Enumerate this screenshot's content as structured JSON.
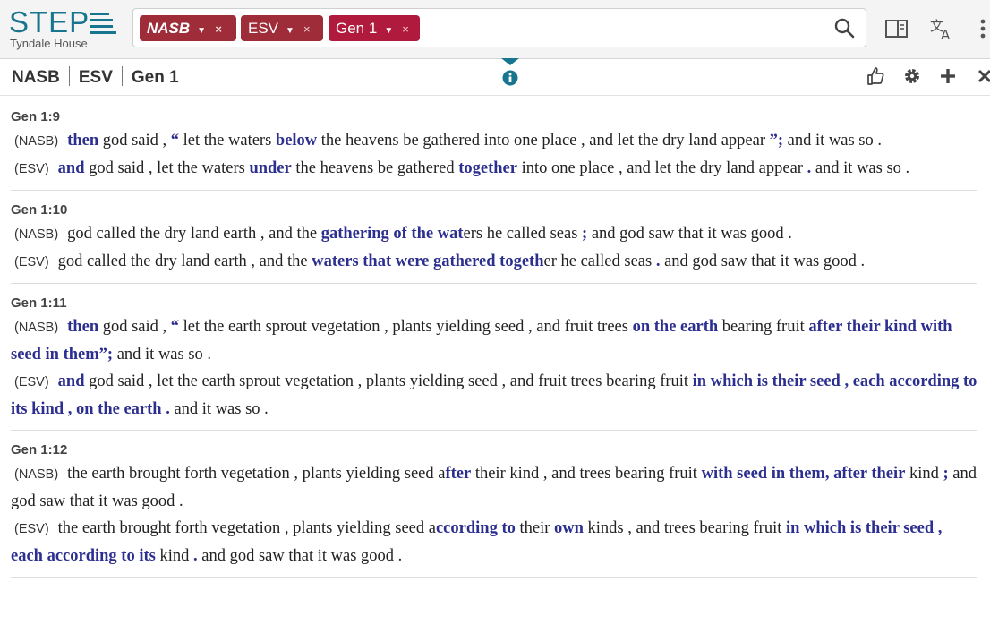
{
  "logo": {
    "name": "STEP",
    "subtitle": "Tyndale House"
  },
  "search_chips": [
    {
      "label": "NASB",
      "remove": "×"
    },
    {
      "label": "ESV",
      "remove": "×"
    },
    {
      "label": "Gen 1",
      "remove": "×"
    }
  ],
  "passage_bar": {
    "versions": [
      "NASB",
      "ESV"
    ],
    "reference": "Gen 1"
  },
  "colors": {
    "brand": "#17758f",
    "chip": "#9e2d39",
    "chip_ref": "#b01a3c",
    "highlight": "#2c2f8f"
  },
  "icons": [
    "search-icon",
    "panel-icon",
    "translate-icon",
    "more-icon",
    "info-icon",
    "thumbs-up-icon",
    "gear-icon",
    "plus-icon",
    "close-icon"
  ],
  "verses": [
    {
      "ref": "Gen 1:9",
      "rows": [
        {
          "version": "(NASB)",
          "segments": [
            {
              "t": "then",
              "h": true
            },
            {
              "t": " god said , "
            },
            {
              "t": "“",
              "h": true
            },
            {
              "t": " let the waters "
            },
            {
              "t": "below",
              "h": true
            },
            {
              "t": " the heavens be gathered into one place , and let the dry land appear "
            },
            {
              "t": "”;",
              "h": true
            },
            {
              "t": " and it was so ."
            }
          ]
        },
        {
          "version": "(ESV)",
          "segments": [
            {
              "t": "and",
              "h": true
            },
            {
              "t": " god said , let the waters "
            },
            {
              "t": "under",
              "h": true
            },
            {
              "t": " the heavens be gathered "
            },
            {
              "t": "together",
              "h": true
            },
            {
              "t": " into one place , and let the dry land appear "
            },
            {
              "t": ".",
              "h": true
            },
            {
              "t": " and it was so ."
            }
          ]
        }
      ]
    },
    {
      "ref": "Gen 1:10",
      "rows": [
        {
          "version": "(NASB)",
          "segments": [
            {
              "t": "god called the dry land earth , and the "
            },
            {
              "t": "gathering of the wat",
              "h": true
            },
            {
              "t": "ers he called seas "
            },
            {
              "t": ";",
              "h": true
            },
            {
              "t": " and god saw that it was good ."
            }
          ]
        },
        {
          "version": "(ESV)",
          "segments": [
            {
              "t": "god called the dry land earth , and the "
            },
            {
              "t": "waters that were gathered togeth",
              "h": true
            },
            {
              "t": "er he called seas "
            },
            {
              "t": ".",
              "h": true
            },
            {
              "t": " and god saw that it was good ."
            }
          ]
        }
      ]
    },
    {
      "ref": "Gen 1:11",
      "rows": [
        {
          "version": "(NASB)",
          "segments": [
            {
              "t": "then",
              "h": true
            },
            {
              "t": " god said , "
            },
            {
              "t": "“",
              "h": true
            },
            {
              "t": " let the earth sprout vegetation , plants yielding seed , and fruit trees "
            },
            {
              "t": "on the earth",
              "h": true
            },
            {
              "t": " bearing fruit "
            },
            {
              "t": "after their kind with seed in them”;",
              "h": true
            },
            {
              "t": " and it was so ."
            }
          ]
        },
        {
          "version": "(ESV)",
          "segments": [
            {
              "t": "and",
              "h": true
            },
            {
              "t": " god said , let the earth sprout vegetation , plants yielding seed , and fruit trees bearing fruit "
            },
            {
              "t": "in which is their seed , each according to its kind , on the earth .",
              "h": true
            },
            {
              "t": " and it was so ."
            }
          ]
        }
      ]
    },
    {
      "ref": "Gen 1:12",
      "rows": [
        {
          "version": "(NASB)",
          "segments": [
            {
              "t": "the earth brought forth vegetation , plants yielding seed a"
            },
            {
              "t": "fter",
              "h": true
            },
            {
              "t": " their kind , and trees bearing fruit "
            },
            {
              "t": "with seed in them, after their",
              "h": true
            },
            {
              "t": " kind "
            },
            {
              "t": ";",
              "h": true
            },
            {
              "t": " and god saw that it was good ."
            }
          ]
        },
        {
          "version": "(ESV)",
          "segments": [
            {
              "t": "the earth brought forth vegetation , plants yielding seed a"
            },
            {
              "t": "ccording to",
              "h": true
            },
            {
              "t": " their "
            },
            {
              "t": "own",
              "h": true
            },
            {
              "t": " kinds , and trees bearing fruit "
            },
            {
              "t": "in which is their seed , each according to its",
              "h": true
            },
            {
              "t": " kind "
            },
            {
              "t": ".",
              "h": true
            },
            {
              "t": " and god saw that it was good ."
            }
          ]
        }
      ]
    }
  ]
}
